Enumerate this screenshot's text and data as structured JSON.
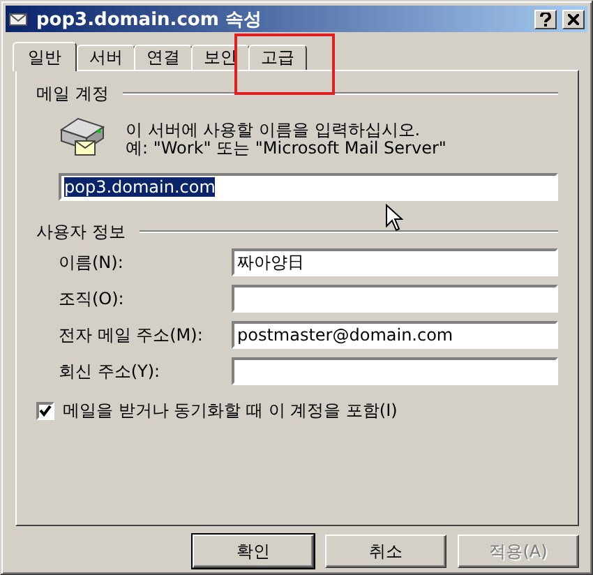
{
  "window": {
    "title": "pop3.domain.com 속성"
  },
  "tabs": [
    {
      "label": "일반",
      "selected": true,
      "highlighted": false
    },
    {
      "label": "서버",
      "selected": false,
      "highlighted": false
    },
    {
      "label": "연결",
      "selected": false,
      "highlighted": false
    },
    {
      "label": "보안",
      "selected": false,
      "highlighted": false
    },
    {
      "label": "고급",
      "selected": false,
      "highlighted": true
    }
  ],
  "mail_account": {
    "heading": "메일 계정",
    "description_lines": [
      "이 서버에 사용할 이름을 입력하십시오.",
      "예: \"Work\" 또는 \"Microsoft Mail Server\""
    ],
    "value": "pop3.domain.com",
    "value_selected": true
  },
  "user_info": {
    "heading": "사용자 정보",
    "fields": [
      {
        "label": "이름(N):",
        "value": "짜아양日"
      },
      {
        "label": "조직(O):"
      },
      {
        "label": "전자 메일 주소(M):",
        "value": "postmaster@domain.com"
      },
      {
        "label": "회신 주소(Y):"
      }
    ]
  },
  "include_account": {
    "label": "메일을 받거나 동기화할 때 이 계정을 포함(I)",
    "checked": true
  },
  "buttons": [
    {
      "label": "확인",
      "default": true,
      "disabled": false
    },
    {
      "label": "취소",
      "default": false,
      "disabled": false
    },
    {
      "label": "적용(A)",
      "default": false,
      "disabled": true
    }
  ]
}
